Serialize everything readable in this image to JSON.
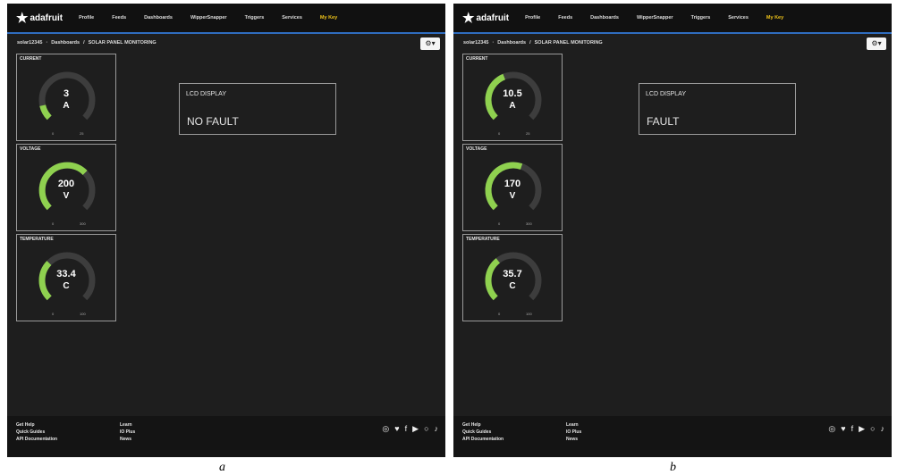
{
  "panels": [
    {
      "logo_text": "adafruit",
      "nav": [
        "Profile",
        "Feeds",
        "Dashboards",
        "WipperSnapper",
        "Triggers",
        "Services",
        "My Key"
      ],
      "breadcrumb": [
        "solar12345",
        "Dashboards",
        "SOLAR PANEL MONITORING"
      ],
      "settings_icon": "gear-icon",
      "gauges": [
        {
          "title": "CURRENT",
          "value": "3",
          "unit": "A",
          "min": "0",
          "max": "25",
          "level": 0.12,
          "color": "#8fd14f"
        },
        {
          "title": "VOLTAGE",
          "value": "200",
          "unit": "V",
          "min": "0",
          "max": "300",
          "level": 0.67,
          "color": "#8fd14f"
        },
        {
          "title": "TEMPERATURE",
          "value": "33.4",
          "unit": "C",
          "min": "0",
          "max": "100",
          "level": 0.33,
          "color": "#8fd14f"
        }
      ],
      "lcd": {
        "title": "LCD DISPLAY",
        "value": "NO FAULT"
      },
      "footer": {
        "left": [
          "Get Help",
          "Quick Guides",
          "API Documentation"
        ],
        "right": [
          "Learn",
          "IO Plus",
          "News"
        ]
      },
      "social_icons": [
        "instagram-icon",
        "twitter-icon",
        "facebook-icon",
        "youtube-icon",
        "github-icon",
        "tiktok-icon"
      ],
      "caption": "a"
    },
    {
      "logo_text": "adafruit",
      "nav": [
        "Profile",
        "Feeds",
        "Dashboards",
        "WipperSnapper",
        "Triggers",
        "Services",
        "My Key"
      ],
      "breadcrumb": [
        "solar12345",
        "Dashboards",
        "SOLAR PANEL MONITORING"
      ],
      "settings_icon": "gear-icon",
      "gauges": [
        {
          "title": "CURRENT",
          "value": "10.5",
          "unit": "A",
          "min": "0",
          "max": "25",
          "level": 0.42,
          "color": "#8fd14f"
        },
        {
          "title": "VOLTAGE",
          "value": "170",
          "unit": "V",
          "min": "0",
          "max": "300",
          "level": 0.57,
          "color": "#8fd14f"
        },
        {
          "title": "TEMPERATURE",
          "value": "35.7",
          "unit": "C",
          "min": "0",
          "max": "100",
          "level": 0.36,
          "color": "#8fd14f"
        }
      ],
      "lcd": {
        "title": "LCD DISPLAY",
        "value": "FAULT"
      },
      "footer": {
        "left": [
          "Get Help",
          "Quick Guides",
          "API Documentation"
        ],
        "right": [
          "Learn",
          "IO Plus",
          "News"
        ]
      },
      "social_icons": [
        "instagram-icon",
        "twitter-icon",
        "facebook-icon",
        "youtube-icon",
        "github-icon",
        "tiktok-icon"
      ],
      "caption": "b"
    }
  ]
}
